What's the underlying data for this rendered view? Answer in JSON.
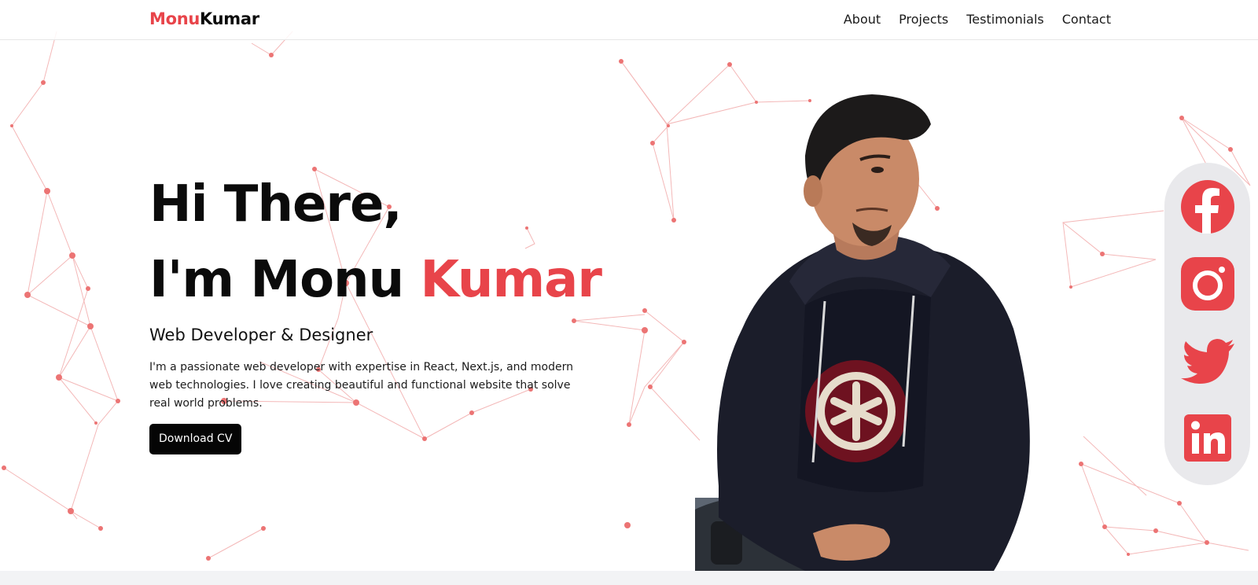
{
  "logo": {
    "first": "Monu",
    "last": "Kumar"
  },
  "nav": {
    "items": [
      {
        "label": "About"
      },
      {
        "label": "Projects"
      },
      {
        "label": "Testimonials"
      },
      {
        "label": "Contact"
      }
    ]
  },
  "hero": {
    "line1": "Hi There,",
    "line2_prefix": "I'm Monu ",
    "line2_accent": "Kumar",
    "role": "Web Developer & Designer",
    "bio": "I'm a passionate web developer with expertise in React, Next.js, and modern web technologies. I love creating beautiful and functional website that solve real world problems.",
    "cta": "Download CV"
  },
  "social": {
    "icons": [
      "facebook-icon",
      "instagram-icon",
      "twitter-icon",
      "linkedin-icon"
    ]
  },
  "colors": {
    "accent": "#e8444a",
    "text": "#0b0b0b",
    "social_bg": "#e9e9ec",
    "button_bg": "#050505"
  }
}
